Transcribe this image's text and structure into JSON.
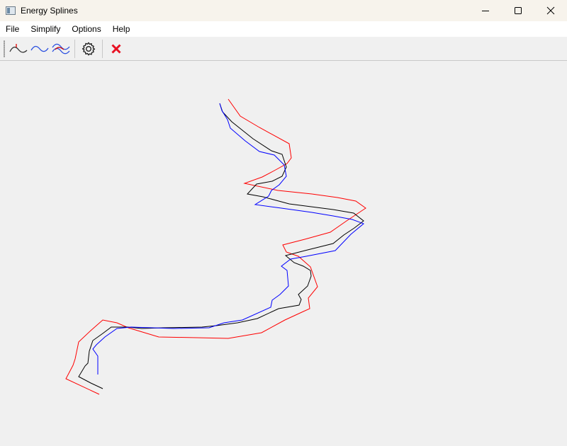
{
  "window": {
    "title": "Energy Splines"
  },
  "menu": {
    "items": [
      "File",
      "Simplify",
      "Options",
      "Help"
    ]
  },
  "toolbar": {
    "tools": [
      "energy-point-icon",
      "blue-spline-icon",
      "compare-splines-icon",
      "gear-icon",
      "delete-icon"
    ]
  },
  "colors": {
    "original": "#000000",
    "simplified": "#0000ff",
    "energy": "#ff0000",
    "delete": "#e81123"
  },
  "curves": {
    "black": [
      [
        310,
        60
      ],
      [
        314,
        72
      ],
      [
        327,
        86
      ],
      [
        357,
        110
      ],
      [
        383,
        127
      ],
      [
        398,
        132
      ],
      [
        404,
        150
      ],
      [
        398,
        163
      ],
      [
        384,
        170
      ],
      [
        362,
        174
      ],
      [
        349,
        188
      ],
      [
        371,
        192
      ],
      [
        408,
        202
      ],
      [
        470,
        210
      ],
      [
        499,
        215
      ],
      [
        513,
        226
      ],
      [
        500,
        236
      ],
      [
        485,
        246
      ],
      [
        470,
        258
      ],
      [
        430,
        268
      ],
      [
        403,
        275
      ],
      [
        415,
        285
      ],
      [
        428,
        290
      ],
      [
        438,
        296
      ],
      [
        439,
        304
      ],
      [
        434,
        318
      ],
      [
        421,
        330
      ],
      [
        425,
        337
      ],
      [
        422,
        345
      ],
      [
        393,
        350
      ],
      [
        363,
        364
      ],
      [
        335,
        370
      ],
      [
        305,
        374
      ],
      [
        285,
        376
      ],
      [
        230,
        377
      ],
      [
        200,
        378
      ],
      [
        180,
        376
      ],
      [
        157,
        376
      ],
      [
        145,
        385
      ],
      [
        131,
        395
      ],
      [
        126,
        410
      ],
      [
        124,
        427
      ],
      [
        120,
        431
      ],
      [
        111,
        446
      ],
      [
        128,
        455
      ],
      [
        145,
        463
      ]
    ],
    "blue": [
      [
        310,
        60
      ],
      [
        313,
        70
      ],
      [
        321,
        83
      ],
      [
        325,
        95
      ],
      [
        346,
        113
      ],
      [
        366,
        128
      ],
      [
        387,
        133
      ],
      [
        401,
        147
      ],
      [
        404,
        163
      ],
      [
        394,
        175
      ],
      [
        383,
        183
      ],
      [
        379,
        191
      ],
      [
        360,
        203
      ],
      [
        397,
        208
      ],
      [
        440,
        214
      ],
      [
        470,
        219
      ],
      [
        497,
        224
      ],
      [
        513,
        230
      ],
      [
        495,
        245
      ],
      [
        473,
        268
      ],
      [
        432,
        276
      ],
      [
        410,
        280
      ],
      [
        397,
        290
      ],
      [
        405,
        296
      ],
      [
        407,
        318
      ],
      [
        395,
        330
      ],
      [
        384,
        338
      ],
      [
        382,
        348
      ],
      [
        342,
        366
      ],
      [
        316,
        370
      ],
      [
        295,
        377
      ],
      [
        245,
        378
      ],
      [
        185,
        376
      ],
      [
        165,
        378
      ],
      [
        148,
        390
      ],
      [
        136,
        401
      ],
      [
        131,
        407
      ],
      [
        138,
        417
      ],
      [
        138,
        443
      ]
    ],
    "red": [
      [
        322,
        54
      ],
      [
        339,
        78
      ],
      [
        366,
        94
      ],
      [
        408,
        117
      ],
      [
        411,
        137
      ],
      [
        405,
        145
      ],
      [
        387,
        155
      ],
      [
        370,
        164
      ],
      [
        345,
        173
      ],
      [
        392,
        183
      ],
      [
        440,
        188
      ],
      [
        476,
        193
      ],
      [
        502,
        198
      ],
      [
        516,
        208
      ],
      [
        501,
        218
      ],
      [
        489,
        226
      ],
      [
        466,
        242
      ],
      [
        430,
        252
      ],
      [
        399,
        260
      ],
      [
        404,
        270
      ],
      [
        421,
        276
      ],
      [
        438,
        291
      ],
      [
        448,
        319
      ],
      [
        435,
        335
      ],
      [
        437,
        350
      ],
      [
        428,
        354
      ],
      [
        402,
        366
      ],
      [
        369,
        384
      ],
      [
        322,
        392
      ],
      [
        278,
        391
      ],
      [
        224,
        390
      ],
      [
        181,
        377
      ],
      [
        165,
        370
      ],
      [
        145,
        366
      ],
      [
        128,
        381
      ],
      [
        111,
        397
      ],
      [
        106,
        421
      ],
      [
        103,
        430
      ],
      [
        93,
        449
      ],
      [
        140,
        471
      ]
    ]
  }
}
